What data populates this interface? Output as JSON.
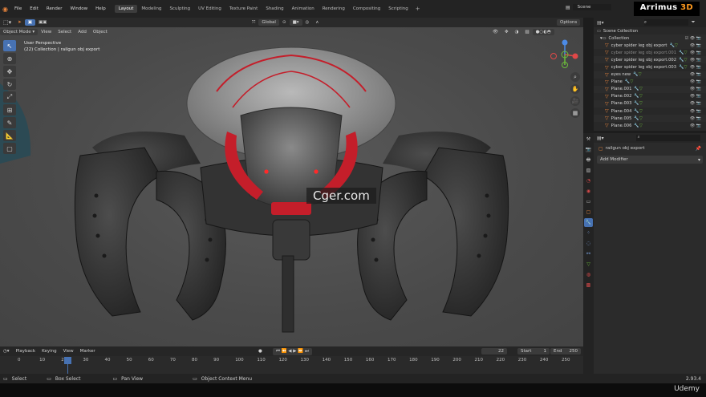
{
  "menu": [
    "File",
    "Edit",
    "Render",
    "Window",
    "Help"
  ],
  "workspaces": [
    {
      "label": "Layout",
      "active": true
    },
    {
      "label": "Modeling"
    },
    {
      "label": "Sculpting"
    },
    {
      "label": "UV Editing"
    },
    {
      "label": "Texture Paint"
    },
    {
      "label": "Shading"
    },
    {
      "label": "Animation"
    },
    {
      "label": "Rendering"
    },
    {
      "label": "Compositing"
    },
    {
      "label": "Scripting"
    }
  ],
  "scene_label": "Scene",
  "brand": {
    "name": "Arrimus",
    "accent": "3D"
  },
  "viewport_header": {
    "mode": "Object Mode",
    "menus": [
      "View",
      "Select",
      "Add",
      "Object"
    ],
    "orientation": "Global",
    "options": "Options"
  },
  "viewport_info": {
    "line1": "User Perspective",
    "line2": "(22) Collection | railgun obj export"
  },
  "watermark": "Cger.com",
  "outliner": {
    "root": "Scene Collection",
    "collection": "Collection",
    "items": [
      {
        "name": "cyber spider leg obj export",
        "dim": false
      },
      {
        "name": "cyber spider leg obj export.001",
        "dim": true
      },
      {
        "name": "cyber spider leg obj export.002",
        "dim": false
      },
      {
        "name": "cyber spider leg obj export.003",
        "dim": false
      },
      {
        "name": "eyes new",
        "dim": false
      },
      {
        "name": "Plane",
        "dim": false
      },
      {
        "name": "Plane.001",
        "dim": false
      },
      {
        "name": "Plane.002",
        "dim": false
      },
      {
        "name": "Plane.003",
        "dim": false
      },
      {
        "name": "Plane.004",
        "dim": false
      },
      {
        "name": "Plane.005",
        "dim": false
      },
      {
        "name": "Plane.006",
        "dim": false
      }
    ]
  },
  "properties": {
    "object_name": "railgun obj export",
    "add_modifier": "Add Modifier"
  },
  "timeline": {
    "menus": [
      "Playback",
      "Keying",
      "View",
      "Marker"
    ],
    "current_frame": "22",
    "start_label": "Start",
    "start": "1",
    "end_label": "End",
    "end": "250",
    "ticks": [
      "0",
      "10",
      "20",
      "30",
      "40",
      "50",
      "60",
      "70",
      "80",
      "90",
      "100",
      "110",
      "120",
      "130",
      "140",
      "150",
      "160",
      "170",
      "180",
      "190",
      "200",
      "210",
      "220",
      "230",
      "240",
      "250"
    ]
  },
  "status": {
    "select": "Select",
    "box_select": "Box Select",
    "pan_view": "Pan View",
    "context_menu": "Object Context Menu",
    "version": "2.93.4"
  },
  "footer": "Udemy",
  "colors": {
    "accent_blue": "#4772b3",
    "spider_red": "#c41e2a",
    "brand_orange": "#ff9a1f"
  }
}
